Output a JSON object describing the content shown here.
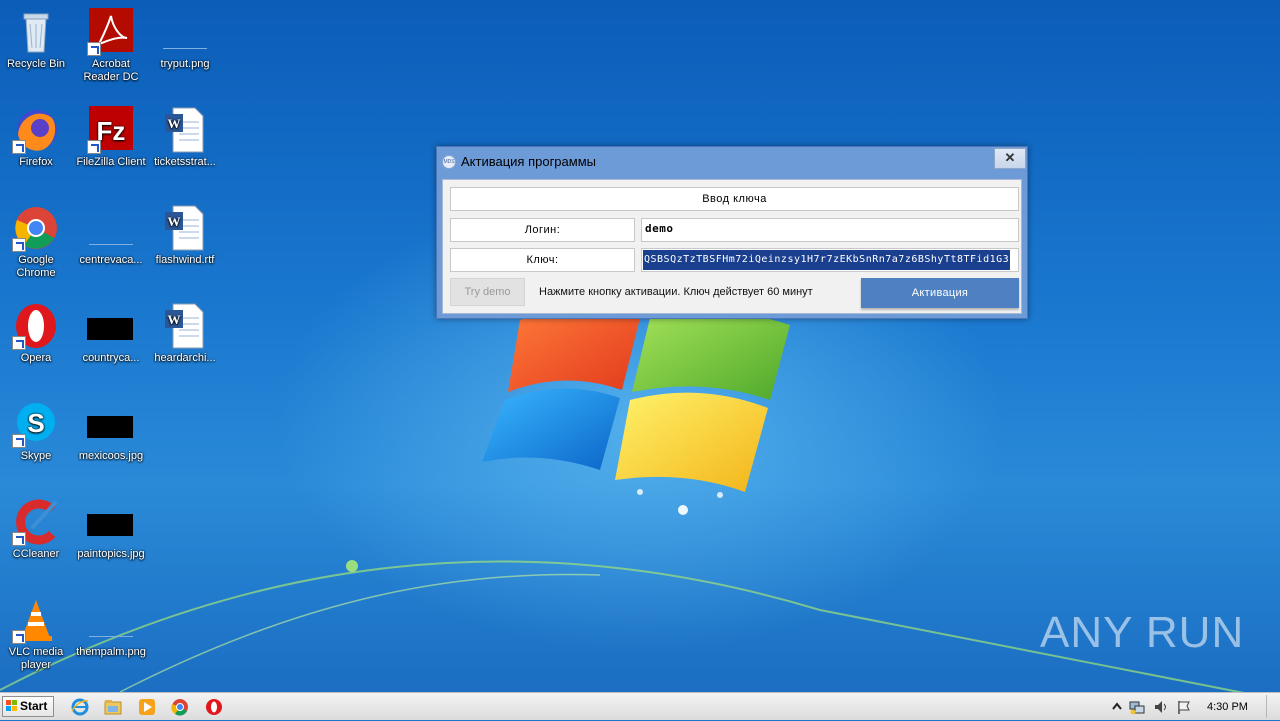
{
  "desktop": {
    "icons": [
      {
        "label": "Recycle Bin",
        "icon": "recycle-bin-icon"
      },
      {
        "label": "Acrobat Reader DC",
        "icon": "acrobat-icon"
      },
      {
        "label": "tryput.png",
        "icon": "image-file-icon"
      },
      {
        "label": "Firefox",
        "icon": "firefox-icon"
      },
      {
        "label": "FileZilla Client",
        "icon": "filezilla-icon"
      },
      {
        "label": "ticketsstrat...",
        "icon": "word-doc-icon"
      },
      {
        "label": "Google Chrome",
        "icon": "chrome-icon"
      },
      {
        "label": "centrevaca...",
        "icon": "image-file-icon"
      },
      {
        "label": "flashwind.rtf",
        "icon": "word-doc-icon"
      },
      {
        "label": "Opera",
        "icon": "opera-icon"
      },
      {
        "label": "countryca...",
        "icon": "image-file-icon"
      },
      {
        "label": "heardarchi...",
        "icon": "word-doc-icon"
      },
      {
        "label": "Skype",
        "icon": "skype-icon"
      },
      {
        "label": "mexicoos.jpg",
        "icon": "image-file-icon"
      },
      {
        "label": "CCleaner",
        "icon": "ccleaner-icon"
      },
      {
        "label": "paintopics.jpg",
        "icon": "image-file-icon"
      },
      {
        "label": "VLC media player",
        "icon": "vlc-icon"
      },
      {
        "label": "thempalm.png",
        "icon": "image-file-icon"
      }
    ],
    "watermark": "ANY RUN"
  },
  "dialog": {
    "title": "Активация программы",
    "app_icon_text": "MDS",
    "close_label": "✕",
    "key_heading": "Ввод ключа",
    "login_label": "Логин:",
    "login_value": "demo",
    "key_label": "Ключ:",
    "key_value": "QSBSQzTzTBSFHm72iQeinzsy1H7r7zEKbSnRn7a7z6BShyTt8TFid1G3",
    "try_demo_label": "Try demo",
    "hint_text": "Нажмите кнопку активации. Ключ действует 60 минут",
    "activate_label": "Активация"
  },
  "taskbar": {
    "start_label": "Start",
    "pinned": [
      "internet-explorer-icon",
      "explorer-folder-icon",
      "media-player-icon",
      "chrome-icon",
      "opera-icon"
    ],
    "tray_icons": [
      "tray-expand-icon",
      "network-icon",
      "volume-icon",
      "action-center-flag-icon"
    ],
    "clock": "4:30 PM"
  }
}
